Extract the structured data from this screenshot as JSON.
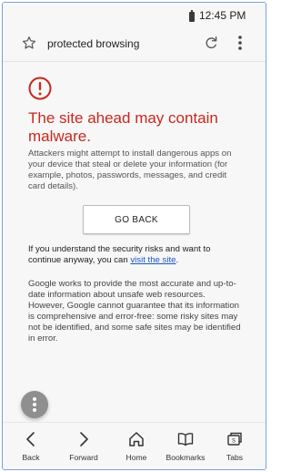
{
  "status_bar": {
    "time": "12:45 PM"
  },
  "toolbar": {
    "address_text": "protected browsing"
  },
  "warning": {
    "headline": "The site ahead may contain malware.",
    "body1": "Attackers might attempt to install dangerous apps on your device that steal or delete your information (for example, photos, passwords, messages, and credit card details).",
    "go_back_label": "GO BACK",
    "risk_text": "If you understand the security risks and want to continue anyway, you can",
    "visit_link": "visit the site",
    "risk_suffix": ".",
    "disclaimer_pre": "Google works to provide the most accurate and up-to-date information about unsafe web resources. However, Google cannot guarantee that its information is comprehensive and error-free: some risky sites may not be identified, and some safe sites may be identified in error."
  },
  "bottom_nav": [
    {
      "label": "Back",
      "icon": "back-icon"
    },
    {
      "label": "Forward",
      "icon": "forward-icon"
    },
    {
      "label": "Home",
      "icon": "home-icon"
    },
    {
      "label": "Bookmarks",
      "icon": "bookmarks-icon"
    },
    {
      "label": "Tabs",
      "icon": "tabs-icon"
    }
  ],
  "colors": {
    "warning_red": "#c8281e",
    "link_blue": "#1a56c8",
    "frame_border": "#7aa0dc"
  }
}
